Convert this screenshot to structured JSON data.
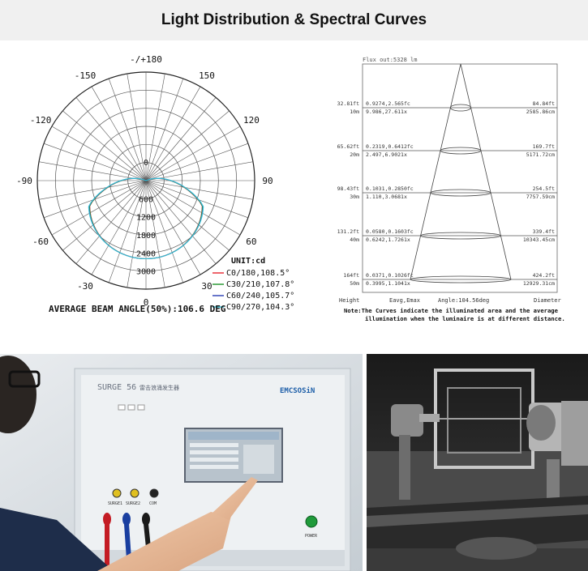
{
  "header": {
    "title": "Light Distribution & Spectral Curves"
  },
  "polar_chart": {
    "angle_labels": [
      "-/+180",
      "150",
      "-150",
      "120",
      "-120",
      "90",
      "-90",
      "60",
      "-60",
      "30",
      "-30",
      "0"
    ],
    "radial_labels": [
      "600",
      "1200",
      "1800",
      "2400",
      "3000"
    ],
    "center_label": "0",
    "unit": "UNIT:cd",
    "legend": [
      {
        "label": "C0/180,108.5°",
        "color": "#e8323c"
      },
      {
        "label": "C30/210,107.8°",
        "color": "#2e9a38"
      },
      {
        "label": "C60/240,105.7°",
        "color": "#3548b8"
      },
      {
        "label": "C90/270,104.3°",
        "color": "#36c0d6"
      }
    ],
    "footer": "AVERAGE BEAM ANGLE(50%):106.6 DEG"
  },
  "chart_data": {
    "type": "table",
    "flux": "Flux out:5328 lm",
    "rows": [
      {
        "height_ft": "32.81ft",
        "height_m": "10m",
        "eav_fc": "0.9274,2.565fc",
        "eav_lx": "9.986,27.611x",
        "dia_ft": "84.84ft",
        "dia_cm": "2585.86cm"
      },
      {
        "height_ft": "65.62ft",
        "height_m": "20m",
        "eav_fc": "0.2319,0.6412fc",
        "eav_lx": "2.497,6.9021x",
        "dia_ft": "169.7ft",
        "dia_cm": "5171.72cm"
      },
      {
        "height_ft": "98.43ft",
        "height_m": "30m",
        "eav_fc": "0.1031,0.2850fc",
        "eav_lx": "1.110,3.0681x",
        "dia_ft": "254.5ft",
        "dia_cm": "7757.59cm"
      },
      {
        "height_ft": "131.2ft",
        "height_m": "40m",
        "eav_fc": "0.0580,0.1603fc",
        "eav_lx": "0.6242,1.7261x",
        "dia_ft": "339.4ft",
        "dia_cm": "10343.45cm"
      },
      {
        "height_ft": "164ft",
        "height_m": "50m",
        "eav_fc": "0.0371,0.1026fc",
        "eav_lx": "0.3995,1.1041x",
        "dia_ft": "424.2ft",
        "dia_cm": "12929.31cm"
      }
    ],
    "footer_labels": {
      "height": "Height",
      "eavg": "Eavg,Emax",
      "angle": "Angle:104.56deg",
      "diameter": "Diameter"
    }
  },
  "note": {
    "line1": "Note:The Curves indicate the illuminated area and the average",
    "line2": "illumination when the luminaire is at different distance."
  },
  "photo_left": {
    "device_model": "SURGE 56",
    "device_subtitle": "雷击浪涌发生器",
    "brand": "EMCSOSiN",
    "ports": [
      "SURGE1",
      "SURGE2",
      "COM"
    ],
    "power_label": "POWER"
  }
}
